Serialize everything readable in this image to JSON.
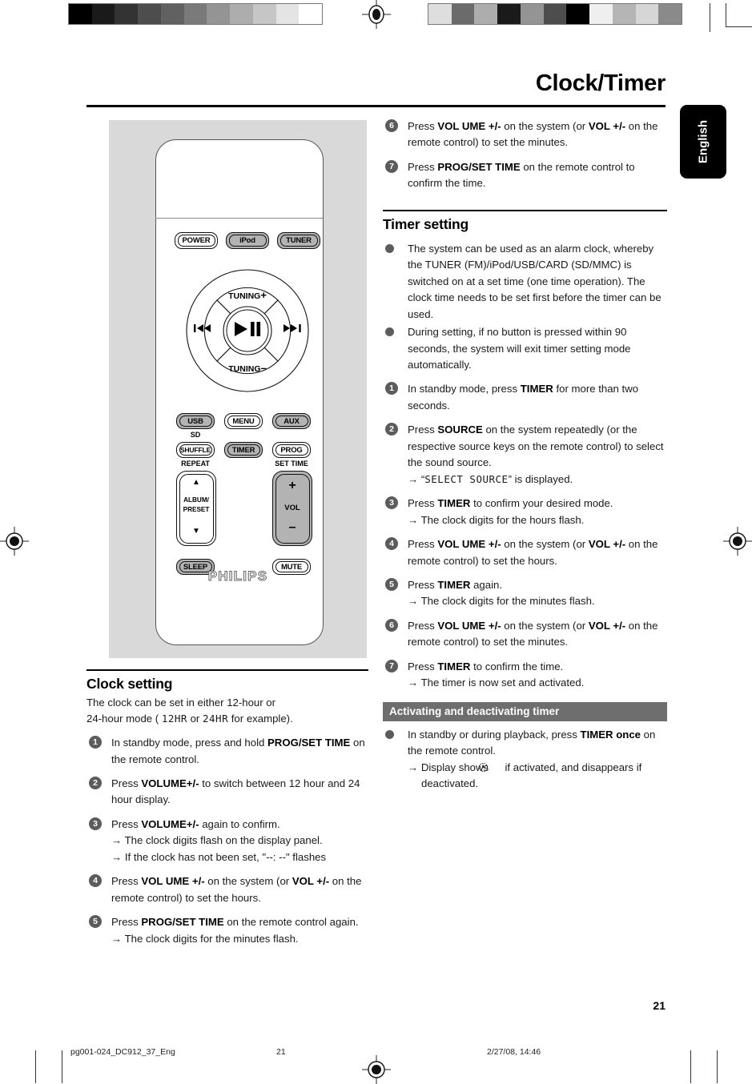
{
  "document": {
    "title": "Clock/Timer",
    "language_tab": "English",
    "page_number": "21"
  },
  "calibration": {
    "left_patches": [
      "#000000",
      "#1a1a1a",
      "#333333",
      "#4d4d4d",
      "#616161",
      "#7a7a7a",
      "#949494",
      "#adadad",
      "#c6c6c6",
      "#e4e4e4",
      "#ffffff"
    ],
    "right_patches": [
      "#dedede",
      "#6b6b6b",
      "#adadad",
      "#1a1a1a",
      "#949494",
      "#4d4d4d",
      "#000000",
      "#efefef",
      "#b5b5b5",
      "#d6d6d6",
      "#8a8a8a"
    ]
  },
  "remote": {
    "brand": "PHILIPS",
    "top_buttons": [
      {
        "label": "POWER",
        "filled": false
      },
      {
        "label": "iPod",
        "filled": true
      },
      {
        "label": "TUNER",
        "filled": true
      }
    ],
    "wheel": {
      "top": "TUNING",
      "top_sign": "+",
      "bottom": "TUNING",
      "bottom_sign": "–",
      "left": "⏮",
      "right": "⏭",
      "center": "▶❘❘"
    },
    "grid_buttons": [
      {
        "label": "USB",
        "filled": true
      },
      {
        "label": "MENU",
        "filled": false
      },
      {
        "label": "AUX",
        "filled": true
      },
      {
        "label": "SHUFFLE",
        "filled": false
      },
      {
        "label": "TIMER",
        "filled": true
      },
      {
        "label": "PROG",
        "filled": false
      },
      {
        "label": "SLEEP",
        "filled": true
      },
      {
        "label": "MUTE",
        "filled": false
      }
    ],
    "sub_labels": {
      "sd": "SD",
      "repeat": "REPEAT",
      "set_time": "SET TIME"
    },
    "album_pad": {
      "up": "▲",
      "line1": "ALBUM/",
      "line2": "PRESET",
      "down": "▼"
    },
    "vol_pad": {
      "plus": "+",
      "label": "VOL",
      "minus": "–"
    }
  },
  "clock_setting": {
    "heading": "Clock setting",
    "intro_a": "The clock can be set in either 12-hour or",
    "intro_b": "24-hour mode ( ",
    "intro_lcd_1": "12HR",
    "intro_mid": " or ",
    "intro_lcd_2": "24HR",
    "intro_c": " for example).",
    "steps": [
      {
        "num": "1",
        "text_a": "In standby mode, press and hold ",
        "bold_a": "PROG/SET TIME",
        "text_b": " on the remote control.",
        "subs": []
      },
      {
        "num": "2",
        "text_a": "Press ",
        "bold_a": "VOLUME+/-",
        "text_b": " to switch between 12 hour and 24 hour display.",
        "subs": []
      },
      {
        "num": "3",
        "text_a": "Press ",
        "bold_a": "VOLUME+/-",
        "text_b": " again to confirm.",
        "subs": [
          "→ The clock digits flash on the display panel.",
          "→ If the clock has not been set, \"--:  --\" flashes"
        ]
      },
      {
        "num": "4",
        "text_a": "Press ",
        "bold_a": "VOL UME +/-",
        "text_b": " on the system (or ",
        "bold_b": "VOL  +/-",
        "text_c": " on the remote control) to set the hours.",
        "subs": []
      },
      {
        "num": "5",
        "text_a": "Press ",
        "bold_a": "PROG/SET TIME",
        "text_b": " on the remote control again.",
        "subs": [
          "→ The clock digits for the minutes flash."
        ]
      }
    ]
  },
  "clock_setting_continued": {
    "steps": [
      {
        "num": "6",
        "text_a": "Press ",
        "bold_a": "VOL UME +/-",
        "text_b": " on the system (or ",
        "bold_b": "VOL  +/-",
        "text_c": " on the remote control) to set the minutes.",
        "subs": []
      },
      {
        "num": "7",
        "text_a": "Press ",
        "bold_a": "PROG/SET TIME",
        "text_b": "  on the remote control to confirm the time.",
        "subs": []
      }
    ]
  },
  "timer_setting": {
    "heading": "Timer setting",
    "bullets": [
      "The system can be used as an alarm clock, whereby the TUNER (FM)/iPod/USB/CARD (SD/MMC) is switched on at a set time (one time operation). The clock time needs to be set first before the timer can be used.",
      "During setting, if no button is pressed within 90 seconds, the system will exit timer setting mode automatically."
    ],
    "steps": [
      {
        "num": "1",
        "text_a": "In standby mode, press ",
        "bold_a": "TIMER",
        "text_b": " for more than two seconds.",
        "subs": []
      },
      {
        "num": "2",
        "text_a": "Press ",
        "bold_a": "SOURCE",
        "text_b": " on the system repeatedly (or the respective source keys on the remote control) to select the sound source.",
        "sub_lcd": {
          "prefix": "→ “",
          "lcd": "SELECT SOURCE",
          "suffix": "” is displayed."
        },
        "subs": []
      },
      {
        "num": "3",
        "text_a": "Press ",
        "bold_a": "TIMER",
        "text_b": " to confirm your desired mode.",
        "subs": [
          "→ The clock digits for the hours flash."
        ]
      },
      {
        "num": "4",
        "text_a": "Press ",
        "bold_a": "VOL UME +/-",
        "text_b": " on the system (or ",
        "bold_b": "VOL  +/-",
        "text_c": " on the remote control) to set the hours.",
        "subs": []
      },
      {
        "num": "5",
        "text_a": "Press ",
        "bold_a": "TIMER",
        "text_b": " again.",
        "subs": [
          "→ The clock digits for the minutes flash."
        ]
      },
      {
        "num": "6",
        "text_a": "Press ",
        "bold_a": "VOL UME +/-",
        "text_b": " on the system (or ",
        "bold_b": "VOL  +/-",
        "text_c": " on the remote control) to set the minutes.",
        "subs": []
      },
      {
        "num": "7",
        "text_a": "Press ",
        "bold_a": "TIMER",
        "text_b": " to confirm the time.",
        "subs": [
          "→ The timer is now set and activated."
        ]
      }
    ]
  },
  "activating": {
    "band_title": "Activating and deactivating timer",
    "text_a": "In standby or during playback, press ",
    "bold_a": "TIMER once",
    "text_b": " on the remote control.",
    "sub_a": "→ Display shows ",
    "sub_b": " if activated, and disappears if deactivated."
  },
  "footer": {
    "file": "pg001-024_DC912_37_Eng",
    "page": "21",
    "date": "2/27/08, 14:46"
  }
}
